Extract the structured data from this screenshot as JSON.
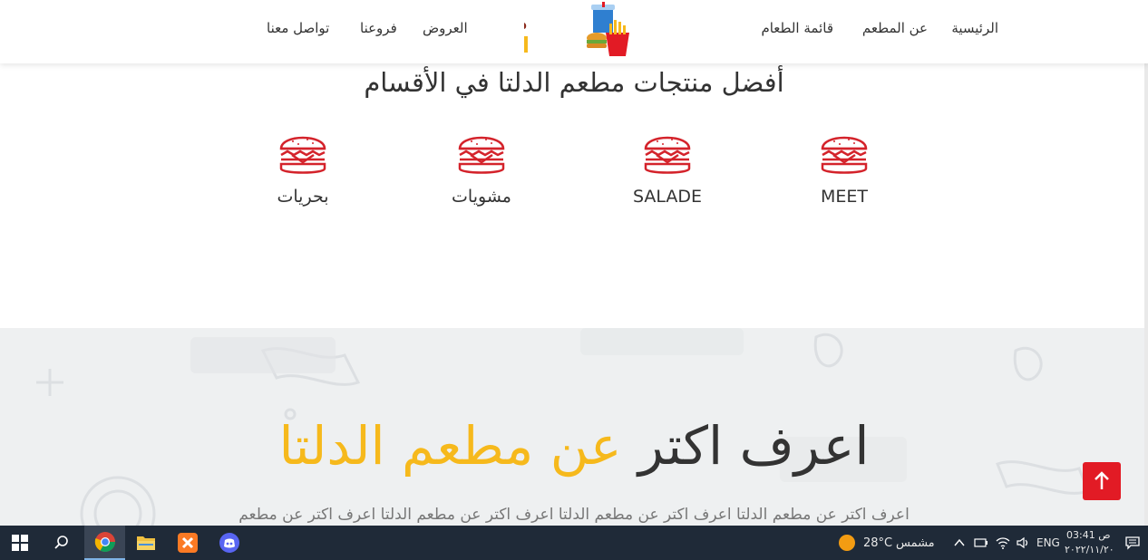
{
  "header": {
    "logo_alt": "مطعم الدلتا",
    "nav": {
      "home": "الرئيسية",
      "about": "عن المطعم",
      "menu": "قائمة الطعام",
      "offers": "العروض",
      "branches": "فروعنا",
      "contact": "تواصل معنا"
    }
  },
  "categories": {
    "title": "أفضل منتجات مطعم الدلتا في الأقسام",
    "items": [
      {
        "label": "MEET",
        "icon": "burger-icon"
      },
      {
        "label": "SALADE",
        "icon": "burger-icon"
      },
      {
        "label": "مشويات",
        "icon": "burger-icon"
      },
      {
        "label": "بحريات",
        "icon": "burger-icon"
      }
    ]
  },
  "about": {
    "heading_dark": "اعرف اكتر",
    "heading_accent": "عن مطعم الدلتا",
    "text": "اعرف اكتر عن مطعم الدلتا اعرف اكتر عن مطعم الدلتا اعرف اكتر عن مطعم الدلتا اعرف اكتر عن مطعم"
  },
  "taskbar": {
    "weather_temp": "28°C",
    "weather_label": "مشمس",
    "language": "ENG",
    "time": "03:41 ص",
    "date": "٢٠٢٢/١١/٢٠"
  },
  "colors": {
    "accent": "#f6b91c",
    "brand_red": "#e21b25",
    "logo_brown": "#8b2a1c",
    "text_dark": "#333333",
    "taskbar": "#1f2a38"
  }
}
